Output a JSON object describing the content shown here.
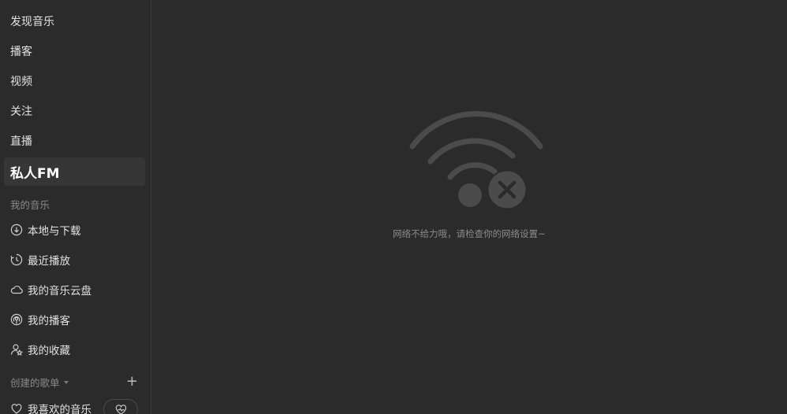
{
  "sidebar": {
    "nav": [
      {
        "label": "发现音乐"
      },
      {
        "label": "播客"
      },
      {
        "label": "视频"
      },
      {
        "label": "关注"
      },
      {
        "label": "直播"
      },
      {
        "label": "私人FM",
        "active": true
      }
    ],
    "my_music": {
      "title": "我的音乐",
      "items": [
        {
          "label": "本地与下载",
          "icon": "download-icon"
        },
        {
          "label": "最近播放",
          "icon": "recent-clock-icon"
        },
        {
          "label": "我的音乐云盘",
          "icon": "cloud-icon"
        },
        {
          "label": "我的播客",
          "icon": "podcast-icon"
        },
        {
          "label": "我的收藏",
          "icon": "user-star-icon"
        }
      ]
    },
    "playlists": {
      "title": "创建的歌单",
      "add_label": "+",
      "items": [
        {
          "label": "我喜欢的音乐",
          "icon": "heart-icon"
        }
      ]
    }
  },
  "main": {
    "offline_message": "网络不给力哦，请检查你的网络设置~",
    "offline_icon": "wifi-disconnected-icon"
  },
  "colors": {
    "background": "#2b2b2b",
    "active_bg": "#363636",
    "icon_gray": "#4b4b4b",
    "muted_text": "#8a8a8a"
  }
}
